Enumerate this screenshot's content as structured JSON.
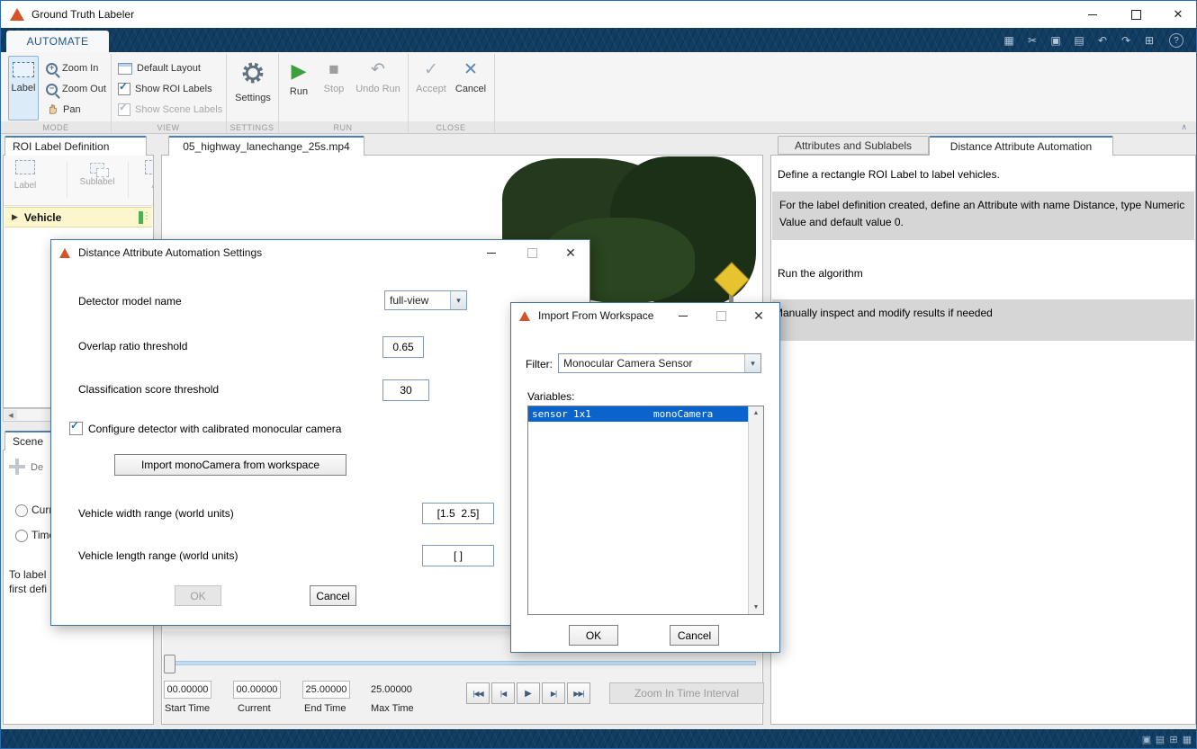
{
  "window": {
    "title": "Ground Truth Labeler"
  },
  "icons": {
    "close_x": "✕",
    "maximize": "□",
    "minimize": "–",
    "save": "▦",
    "cut": "✂",
    "copy": "▣",
    "paste": "▤",
    "undo": "↶",
    "redo": "↷",
    "window_pair": "⊞",
    "help": "?",
    "collapse": "∧",
    "dropdown_chevron": "▾",
    "check": "✓",
    "play": "▶",
    "stop": "■",
    "undo_run": "↶",
    "accept": "✓",
    "cancel": "✕",
    "expand_right": "▶",
    "dots": "⋮",
    "scroll_left": "◀",
    "scroll_up": "▲",
    "scroll_down": "▼",
    "first_frame": "|◀◀",
    "prev_frame": "|◀",
    "next_frame": "▶|",
    "last_frame": "▶▶|",
    "plus": "+",
    "minus": "−"
  },
  "ribbon": {
    "tab": "AUTOMATE",
    "mode": {
      "label": "Label",
      "zoom_in": "Zoom In",
      "zoom_out": "Zoom Out",
      "pan": "Pan"
    },
    "view": {
      "default_layout": "Default Layout",
      "show_roi": "Show ROI Labels",
      "show_scene": "Show Scene Labels"
    },
    "settings": "Settings",
    "run": {
      "run": "Run",
      "stop": "Stop",
      "undo_run": "Undo Run"
    },
    "close": {
      "accept": "Accept",
      "cancel": "Cancel"
    },
    "sections": [
      "MODE",
      "VIEW",
      "SETTINGS",
      "RUN",
      "CLOSE"
    ]
  },
  "roi_panel": {
    "tab": "ROI Label Definition",
    "buttons": [
      "Label",
      "Sublabel",
      "A"
    ],
    "items": [
      {
        "label": "Vehicle"
      }
    ]
  },
  "scene_panel": {
    "tab": "Scene",
    "add_fragment": "De",
    "radio_current": "Curre",
    "radio_time": "Time",
    "note_line1": "To label",
    "note_line2": "first defi"
  },
  "video": {
    "tab": "05_highway_lanechange_25s.mp4",
    "start_value": "00.00000",
    "current_value": "00.00000",
    "end_value": "25.00000",
    "max_value": "25.00000",
    "start_label": "Start Time",
    "current_label": "Current",
    "end_label": "End Time",
    "max_label": "Max Time",
    "zoom_button": "Zoom In Time Interval"
  },
  "right_panel": {
    "tabs": [
      "Attributes and Sublabels",
      "Distance Attribute Automation"
    ],
    "instructions": [
      {
        "text": "Define a rectangle ROI Label to label vehicles."
      },
      {
        "text": "For the label definition created, define an Attribute with name Distance, type Numeric Value and default value 0."
      },
      {
        "text": "Run the algorithm"
      },
      {
        "text": "Manually inspect and modify results if needed"
      }
    ]
  },
  "settings_dialog": {
    "title": "Distance Attribute Automation Settings",
    "detector_label": "Detector model name",
    "detector_value": "full-view",
    "overlap_label": "Overlap ratio threshold",
    "overlap_value": "0.65",
    "score_label": "Classification score threshold",
    "score_value": "30",
    "camera_checkbox": "Configure detector with calibrated monocular camera",
    "import_button": "Import monoCamera from workspace",
    "width_label": "Vehicle width range (world units)",
    "width_value": "[1.5  2.5]",
    "length_label": "Vehicle length range (world units)",
    "length_value": "[ ]",
    "ok": "OK",
    "cancel": "Cancel"
  },
  "import_dialog": {
    "title": "Import From Workspace",
    "filter_label": "Filter:",
    "filter_value": "Monocular Camera Sensor",
    "variables_label": "Variables:",
    "row": {
      "name": "sensor",
      "size": "1x1",
      "cls": "monoCamera"
    },
    "ok": "OK",
    "cancel": "Cancel"
  },
  "colors": {
    "selection_blue": "#0a64cc",
    "ribbon_navy": "#123d63",
    "highlight_gray": "#d6d6d6",
    "label_green": "#4fae54",
    "sign_yellow": "#e6c32f",
    "run_green": "#3c9e3c",
    "accent_blue": "#4f7fae"
  }
}
